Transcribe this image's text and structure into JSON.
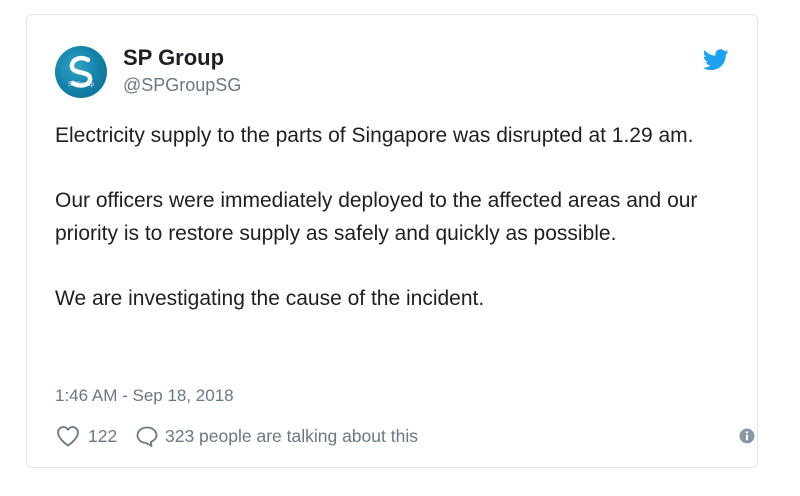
{
  "tweet": {
    "author": {
      "name": "SP Group",
      "handle": "@SPGroupSG",
      "avatar_icon": "sp-group-logo",
      "avatar_text": "SPGroup"
    },
    "platform_icon": "twitter-bird-icon",
    "paragraphs": [
      "Electricity supply to the parts of Singapore was disrupted at 1.29 am.",
      "Our officers were immediately deployed to the affected areas and our priority is to restore supply as safely and quickly as possible.",
      "We are investigating the cause of the incident."
    ],
    "timestamp": "1:46 AM - Sep 18, 2018",
    "likes": {
      "icon": "heart-icon",
      "count": "122"
    },
    "replies": {
      "icon": "speech-bubble-icon",
      "text": "323 people are talking about this"
    },
    "info_icon": "info-icon"
  },
  "colors": {
    "text_primary": "#1c2022",
    "text_secondary": "#697882",
    "twitter_blue": "#1da1f2",
    "avatar_blue": "#137fa6"
  }
}
